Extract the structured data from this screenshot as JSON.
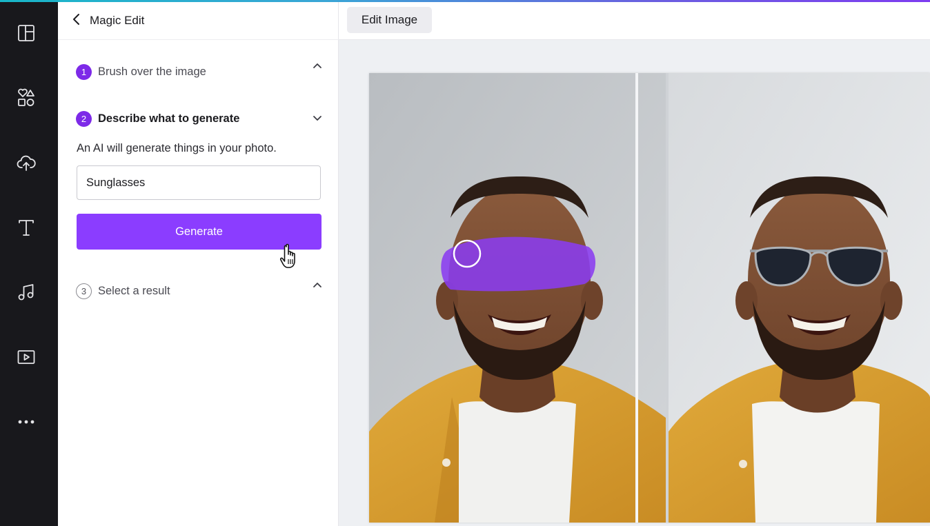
{
  "rail": {
    "items": [
      {
        "name": "design",
        "icon": "layout-icon"
      },
      {
        "name": "elements",
        "icon": "shapes-icon"
      },
      {
        "name": "uploads",
        "icon": "cloud-upload-icon"
      },
      {
        "name": "text",
        "icon": "text-icon"
      },
      {
        "name": "audio",
        "icon": "music-note-icon"
      },
      {
        "name": "videos",
        "icon": "video-play-icon"
      },
      {
        "name": "more",
        "icon": "more-dots-icon"
      }
    ]
  },
  "panel": {
    "title": "Magic Edit",
    "steps": [
      {
        "number": "1",
        "label": "Brush over the image",
        "state": "done"
      },
      {
        "number": "2",
        "label": "Describe what to generate",
        "state": "active"
      },
      {
        "number": "3",
        "label": "Select a result",
        "state": "pending"
      }
    ],
    "description": "An AI will generate things in your photo.",
    "prompt_value": "Sunglasses",
    "generate_label": "Generate"
  },
  "topbar": {
    "edit_image_label": "Edit Image"
  },
  "colors": {
    "accent": "#8b3dff",
    "step_badge": "#7d2ae8",
    "rail_bg": "#18181c",
    "brush": "#8a3cf0"
  }
}
